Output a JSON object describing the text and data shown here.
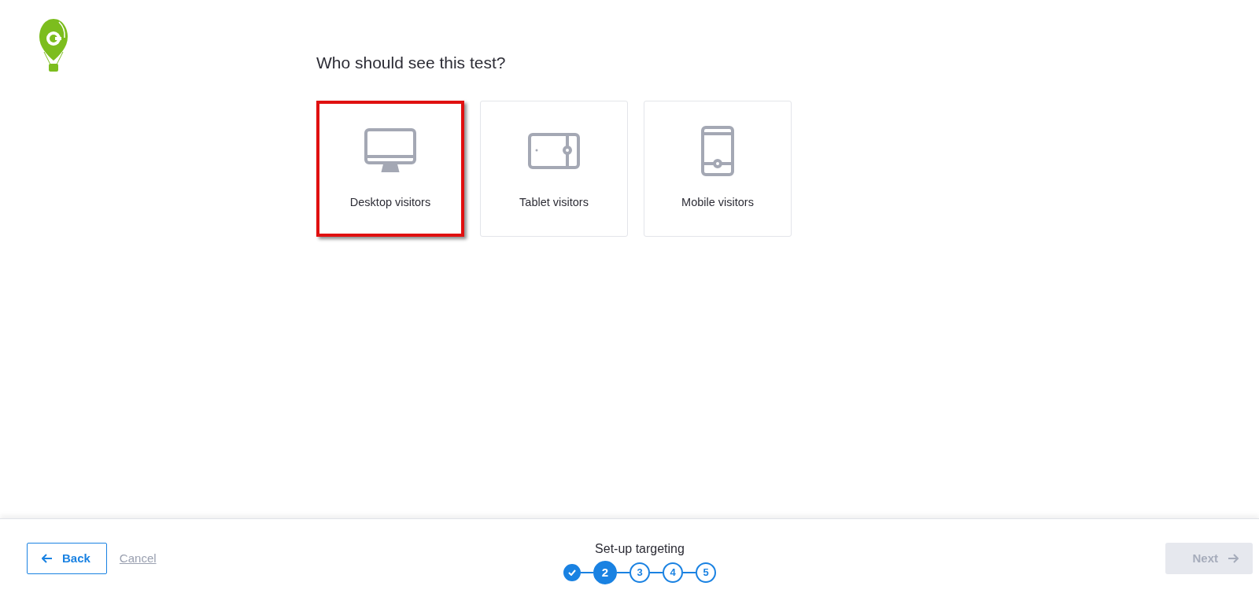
{
  "heading": "Who should see this test?",
  "options": [
    {
      "kind": "desktop",
      "label": "Desktop visitors",
      "selected": true
    },
    {
      "kind": "tablet",
      "label": "Tablet visitors",
      "selected": false
    },
    {
      "kind": "mobile",
      "label": "Mobile visitors",
      "selected": false
    }
  ],
  "footer": {
    "back": "Back",
    "cancel": "Cancel",
    "step_title": "Set-up targeting",
    "steps": [
      {
        "kind": "done"
      },
      {
        "kind": "current",
        "label": "2"
      },
      {
        "kind": "pending",
        "label": "3"
      },
      {
        "kind": "pending",
        "label": "4"
      },
      {
        "kind": "pending",
        "label": "5"
      }
    ],
    "next": {
      "label": "Next",
      "disabled": true
    }
  }
}
